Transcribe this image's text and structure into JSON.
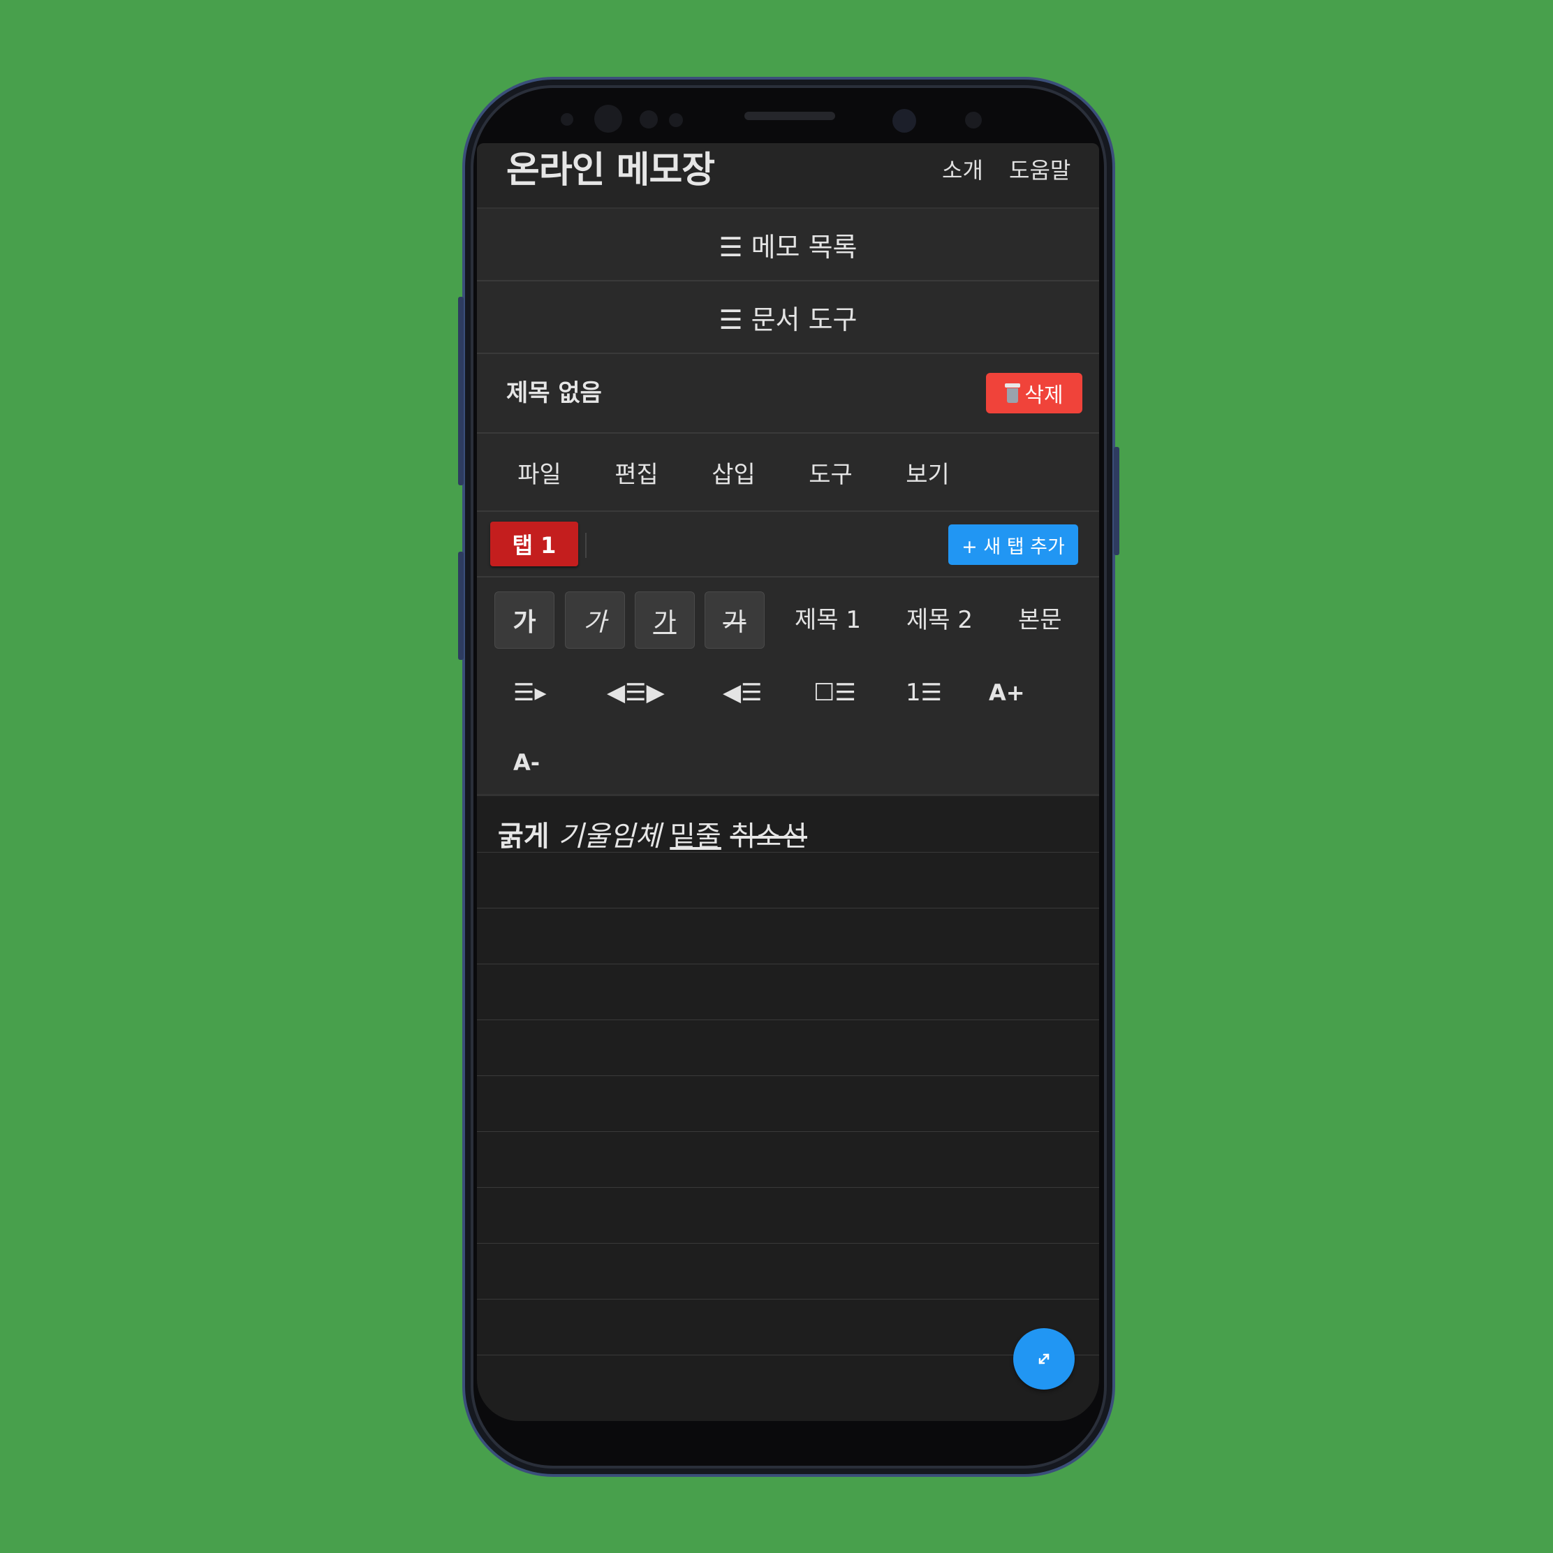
{
  "app": {
    "title": "온라인 메모장",
    "nav": [
      "소개",
      "도움말"
    ]
  },
  "panels": {
    "memo_list": "☰ 메모 목록",
    "doc_tools": "☰ 문서 도구"
  },
  "document": {
    "title": "제목 없음",
    "delete_label": "삭제"
  },
  "menu": [
    "파일",
    "편집",
    "삽입",
    "도구",
    "보기"
  ],
  "tabs": {
    "active": "탭 1",
    "new_tab_label": "+ 새 탭 추가"
  },
  "toolbar": {
    "bold": "가",
    "italic": "가",
    "underline": "가",
    "strike": "가",
    "heading1": "제목 1",
    "heading2": "제목 2",
    "body": "본문",
    "indent": "☰▸",
    "center": "◀☰▶",
    "outdent": "◀☰",
    "checklist": "☐☰",
    "numbered": "1☰",
    "font_up": "A+",
    "font_down": "A-"
  },
  "editor": {
    "bold_text": "굵게",
    "italic_text": "기울임체",
    "underline_text": "밑줄",
    "strike_text": "취소선"
  },
  "colors": {
    "background": "#48a04c",
    "delete": "#f0433a",
    "active_tab": "#c41e1e",
    "accent": "#2196f3"
  }
}
